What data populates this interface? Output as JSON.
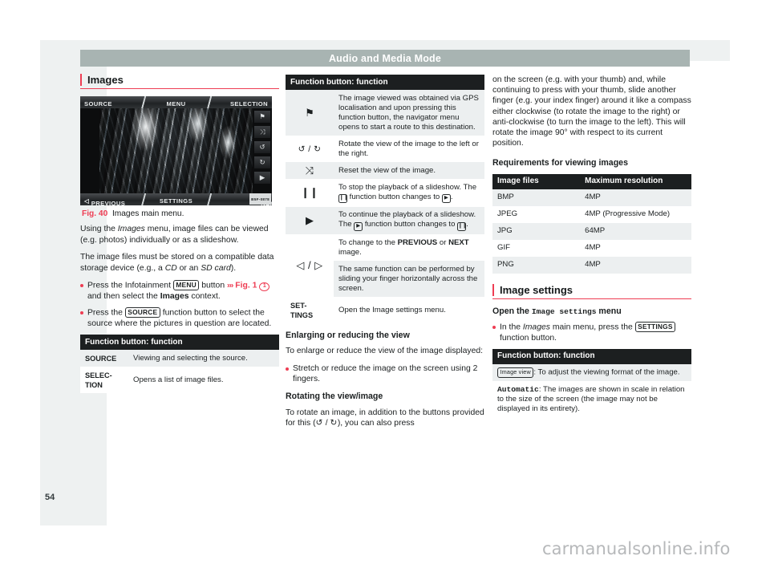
{
  "document": {
    "running_header": "Audio and Media Mode",
    "page_number": "54",
    "watermark": "carmanualsonline.info"
  },
  "left_column": {
    "heading": "Images",
    "figure": {
      "top_buttons": [
        "SOURCE",
        "MENU",
        "SELECTION"
      ],
      "bottom_buttons": [
        "PREVIOUS",
        "SETTINGS",
        "NEXT"
      ],
      "side_buttons": [
        "⚑",
        "⤨",
        "↺",
        "↻",
        "▶"
      ],
      "image_code": "B5F-0878",
      "caption_number": "Fig. 40",
      "caption_text": "Images main menu."
    },
    "paragraph_1_a": "Using the ",
    "paragraph_1_italic": "Images",
    "paragraph_1_b": " menu, image files can be viewed (e.g. photos) individually or as a slideshow.",
    "paragraph_2_a": "The image files must be stored on a compatible data storage device (e.g., a ",
    "paragraph_2_it1": "CD",
    "paragraph_2_b": " or an ",
    "paragraph_2_it2": "SD card",
    "paragraph_2_c": ").",
    "bullet_1_a": "Press the Infotainment ",
    "bullet_1_key": "MENU",
    "bullet_1_b": " button ",
    "bullet_1_xref_arrows": "›››",
    "bullet_1_xref": "Fig. 1",
    "bullet_1_callout": "1",
    "bullet_1_c": " and then select the ",
    "bullet_1_bold": "Images",
    "bullet_1_d": " context.",
    "bullet_2_a": "Press the ",
    "bullet_2_key": "SOURCE",
    "bullet_2_b": " function button to select the source where the pictures in question are located.",
    "table": {
      "header": "Function button: function",
      "rows": [
        {
          "button": "SOURCE",
          "function": "Viewing and selecting the source."
        },
        {
          "button": "SELEC-\nTION",
          "function": "Opens a list of image files."
        }
      ]
    }
  },
  "middle_column": {
    "table": {
      "header": "Function button: function",
      "rows": [
        {
          "icon": "flag-icon",
          "glyph": "⚑",
          "function": "The image viewed was obtained via GPS localisation and upon pressing this function button, the navigator menu opens to start a route to this destination."
        },
        {
          "icon": "rotate-left-right-icon",
          "glyph": "↺ / ↻",
          "function": "Rotate the view of the image to the left or the right."
        },
        {
          "icon": "reset-view-icon",
          "glyph": "⤨",
          "function": "Reset the view of the image."
        },
        {
          "icon": "pause-icon",
          "glyph": "❙❙",
          "function_a": "To stop the playback of a slideshow. The ",
          "function_key": "❙❙",
          "function_b": " function button changes to ",
          "function_key2": "▶",
          "function_c": "."
        },
        {
          "icon": "play-icon",
          "glyph": "▶",
          "function_a": "To continue the playback of a slideshow. The ",
          "function_key": "▶",
          "function_b": " function button changes to ",
          "function_key2": "❙❙",
          "function_c": "."
        },
        {
          "icon": "previous-next-icon",
          "glyph": "◁ / ▷",
          "function_a": "To change to the ",
          "function_bold_1": "PREVIOUS",
          "function_b": " or ",
          "function_bold_2": "NEXT",
          "function_c": " image.",
          "function_second_row": "The same function can be performed by sliding your finger horizontally across the screen."
        },
        {
          "icon": "settings-button",
          "button": "SET-\nTINGS",
          "function": "Open the Image settings menu."
        }
      ]
    },
    "heading_enlarge": "Enlarging or reducing the view",
    "paragraph_enlarge": "To enlarge or reduce the view of the image displayed:",
    "bullet_enlarge": "Stretch or reduce the image on the screen using 2 fingers.",
    "heading_rotate": "Rotating the view/image",
    "paragraph_rotate_a": "To rotate an image, in addition to the buttons provided for this (",
    "paragraph_rotate_icon1": "↺",
    "paragraph_rotate_mid": " / ",
    "paragraph_rotate_icon2": "↻",
    "paragraph_rotate_b": "), you can also press"
  },
  "right_column": {
    "paragraph_continue": "on the screen (e.g. with your thumb) and, while continuing to press with your thumb, slide another finger (e.g. your index finger) around it like a compass either clockwise (to rotate the image to the right) or anti-clockwise (to turn the image to the left). This will rotate the image 90° with respect to its current position.",
    "heading_requirements": "Requirements for viewing images",
    "resolution_table": {
      "columns": [
        "Image files",
        "Maximum resolution"
      ],
      "rows": [
        [
          "BMP",
          "4MP"
        ],
        [
          "JPEG",
          "4MP (Progressive Mode)"
        ],
        [
          "JPG",
          "64MP"
        ],
        [
          "GIF",
          "4MP"
        ],
        [
          "PNG",
          "4MP"
        ]
      ]
    },
    "heading_image_settings": "Image settings",
    "subheading_open_a": "Open the ",
    "subheading_open_mono": "Image settings",
    "subheading_open_b": " menu",
    "bullet_settings_a": "In the ",
    "bullet_settings_italic": "Images",
    "bullet_settings_b": " main menu, press the ",
    "bullet_settings_key": "SETTINGS",
    "bullet_settings_c": " function button.",
    "settings_table": {
      "header": "Function button: function",
      "row_key": "Image view",
      "row_function": ": To adjust the viewing format of the image.",
      "sub_bold": "Automatic",
      "sub_text": ": The images are shown in scale in relation to the size of the screen (the image may not be displayed in its entirety)."
    }
  }
}
